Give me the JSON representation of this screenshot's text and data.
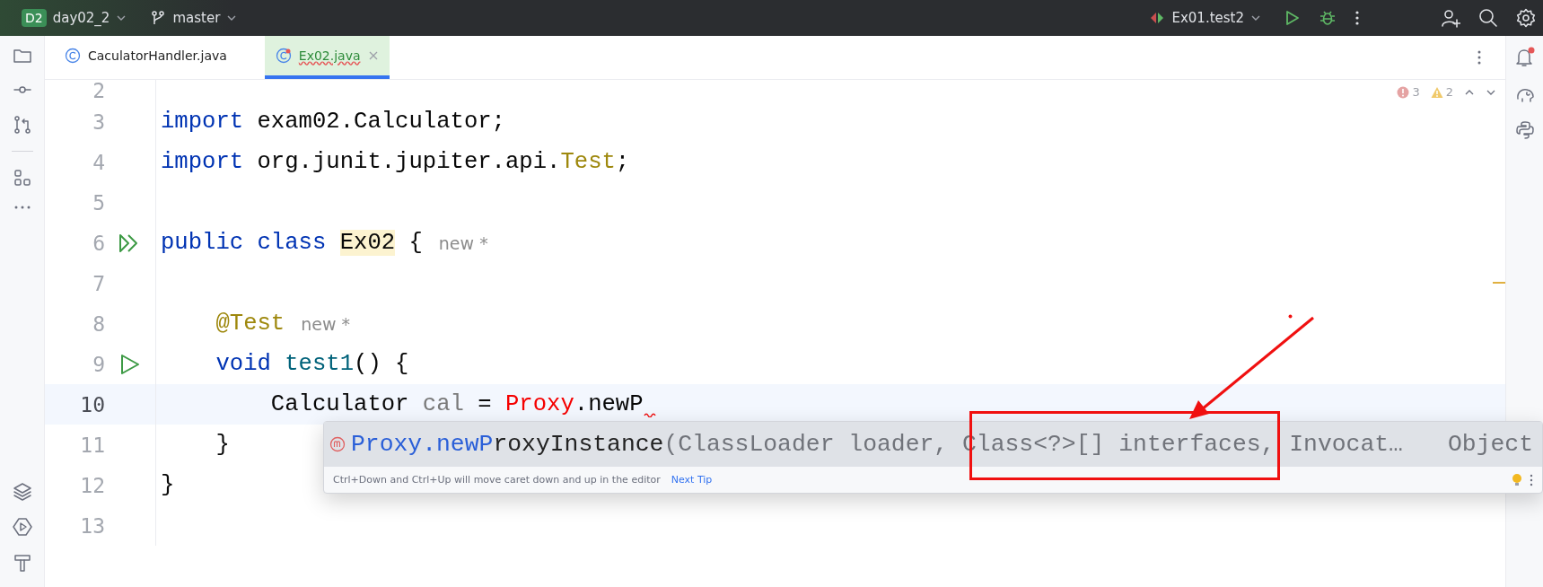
{
  "title_bar": {
    "project_badge": "D2",
    "project": "day02_2",
    "branch": "master",
    "run_config": "Ex01.test2"
  },
  "tabs": [
    {
      "label": "CaculatorHandler.java",
      "selected": false,
      "modified": false
    },
    {
      "label": "Ex02.java",
      "selected": true,
      "modified": true
    }
  ],
  "inspections": {
    "errors": "3",
    "warnings": "2"
  },
  "editor": {
    "lines": [
      {
        "number": "2",
        "kind": "partial",
        "current": false
      },
      {
        "number": "3",
        "kind": "code",
        "current": false,
        "tokens": [
          {
            "kind": "keyword",
            "text": "import"
          },
          {
            "kind": "plain",
            "text": " exam02.Calculator;"
          }
        ]
      },
      {
        "number": "4",
        "kind": "code",
        "current": false,
        "tokens": [
          {
            "kind": "keyword",
            "text": "import"
          },
          {
            "kind": "plain",
            "text": " org.junit.jupiter.api."
          },
          {
            "kind": "annotation",
            "text": "Test"
          },
          {
            "kind": "plain",
            "text": ";"
          }
        ]
      },
      {
        "number": "5",
        "kind": "code",
        "current": false
      },
      {
        "number": "6",
        "kind": "run-class",
        "current": false,
        "tokens": [
          {
            "kind": "keyword",
            "text": "public class "
          },
          {
            "kind": "highlight",
            "text": "Ex02"
          },
          {
            "kind": "plain",
            "text": " {"
          },
          {
            "kind": "hint",
            "text": "new *"
          }
        ]
      },
      {
        "number": "7",
        "kind": "code",
        "current": false
      },
      {
        "number": "8",
        "kind": "code",
        "current": false,
        "tokens": [
          {
            "kind": "annotation",
            "text": "    @Test"
          },
          {
            "kind": "hint",
            "text": "new *"
          }
        ]
      },
      {
        "number": "9",
        "kind": "run-method",
        "current": false,
        "tokens": [
          {
            "kind": "keyword",
            "text": "    void"
          },
          {
            "kind": "method",
            "text": " test1"
          },
          {
            "kind": "plain",
            "text": "() {"
          }
        ]
      },
      {
        "number": "10",
        "kind": "code",
        "current": true,
        "error_mark": true,
        "tokens": [
          {
            "kind": "plain",
            "text": "        Calculator"
          },
          {
            "kind": "unused",
            "text": " cal"
          },
          {
            "kind": "plain",
            "text": " = "
          },
          {
            "kind": "error",
            "text": "Proxy"
          },
          {
            "kind": "plain",
            "text": ".newP"
          }
        ]
      },
      {
        "number": "11",
        "kind": "code",
        "current": false,
        "tokens": [
          {
            "kind": "plain",
            "text": "    }"
          }
        ]
      },
      {
        "number": "12",
        "kind": "code",
        "current": false,
        "tokens": [
          {
            "kind": "plain",
            "text": "}"
          }
        ]
      },
      {
        "number": "13",
        "kind": "code",
        "current": false
      }
    ]
  },
  "completion": {
    "matched": "Proxy.newP",
    "rest": "roxyInstance",
    "params": "(ClassLoader loader, Class<?>[] interfaces, Invocat…",
    "return_type": "Object",
    "tip": "Ctrl+Down and Ctrl+Up will move caret down and up in the editor",
    "tip_link": "Next Tip"
  }
}
